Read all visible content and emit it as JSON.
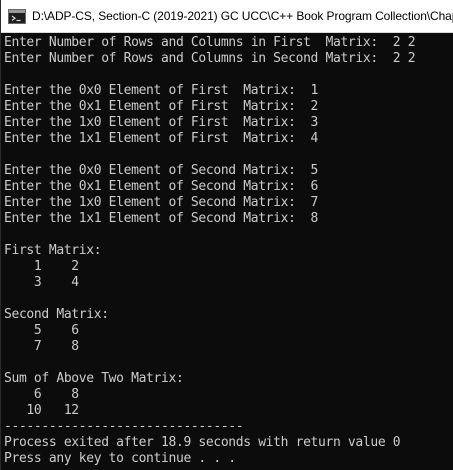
{
  "window": {
    "title": "D:\\ADP-CS, Section-C (2019-2021) GC UCC\\C++ Book Program Collection\\Chap"
  },
  "icons": {
    "app_icon": "console-window-icon"
  },
  "colors": {
    "console_background": "#0c0c0c",
    "console_text": "#cccccc",
    "titlebar_background": "#ffffff"
  },
  "console": {
    "lines": [
      "Enter Number of Rows and Columns in First  Matrix:  2 2",
      "Enter Number of Rows and Columns in Second Matrix:  2 2",
      "",
      "Enter the 0x0 Element of First  Matrix:  1",
      "Enter the 0x1 Element of First  Matrix:  2",
      "Enter the 1x0 Element of First  Matrix:  3",
      "Enter the 1x1 Element of First  Matrix:  4",
      "",
      "Enter the 0x0 Element of Second Matrix:  5",
      "Enter the 0x1 Element of Second Matrix:  6",
      "Enter the 1x0 Element of Second Matrix:  7",
      "Enter the 1x1 Element of Second Matrix:  8",
      "",
      "First Matrix:",
      "    1    2",
      "    3    4",
      "",
      "Second Matrix:",
      "    5    6",
      "    7    8",
      "",
      "Sum of Above Two Matrix:",
      "    6    8",
      "   10   12",
      "--------------------------------",
      "Process exited after 18.9 seconds with return value 0",
      "Press any key to continue . . ."
    ]
  }
}
